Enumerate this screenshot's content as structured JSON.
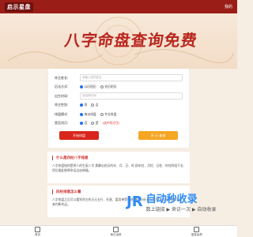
{
  "topbar": {
    "logo": "启示星盘",
    "right_link": "我的"
  },
  "banner": {
    "title": "八字命盘查询免费"
  },
  "form": {
    "rows": [
      {
        "label": "命主姓名:",
        "type": "input",
        "placeholder": "请输入您的姓名"
      },
      {
        "label": "历法方式:",
        "type": "radio",
        "options": [
          "公历阳历",
          "农历阴历"
        ],
        "selected": 0
      },
      {
        "label": "出生时间:",
        "type": "input",
        "placeholder": "请选择时间"
      },
      {
        "label": "命主性别:",
        "type": "radio",
        "options": [
          "男",
          "女"
        ],
        "selected": 0
      },
      {
        "label": "排盘模式:",
        "type": "radio",
        "options": [
          "南派排盘",
          "专业排盘"
        ],
        "selected": 0
      },
      {
        "label": "是否闰月:",
        "type": "radio",
        "options": [
          "否",
          "是"
        ],
        "selected": 0,
        "hint": "(选中闰月生)"
      }
    ],
    "submit_label": "开始排盘",
    "history_label": "开 示 查询"
  },
  "sections": [
    {
      "title": "什么是四柱八字排盘",
      "text": "八字排盘指的是将人的生辰八字,换算出农历的年、月、日、时,即年柱、月柱、日柱、时柱四组干支,然后据此推断命运吉凶祸福。"
    },
    {
      "title": "四柱排盘怎么看",
      "text": "八字排盘之后可以看到命主的日元五行、旺衰、喜用神等信息,通过分析五行生克、刑冲合害等关系来判断命运。"
    }
  ],
  "bottom_nav": [
    "首页",
    "每日运势",
    "星座运势"
  ],
  "watermark": {
    "brand": "自动秒收录",
    "sub": "数上链接 ▶ 来访一次 ▶ 自动收录"
  }
}
